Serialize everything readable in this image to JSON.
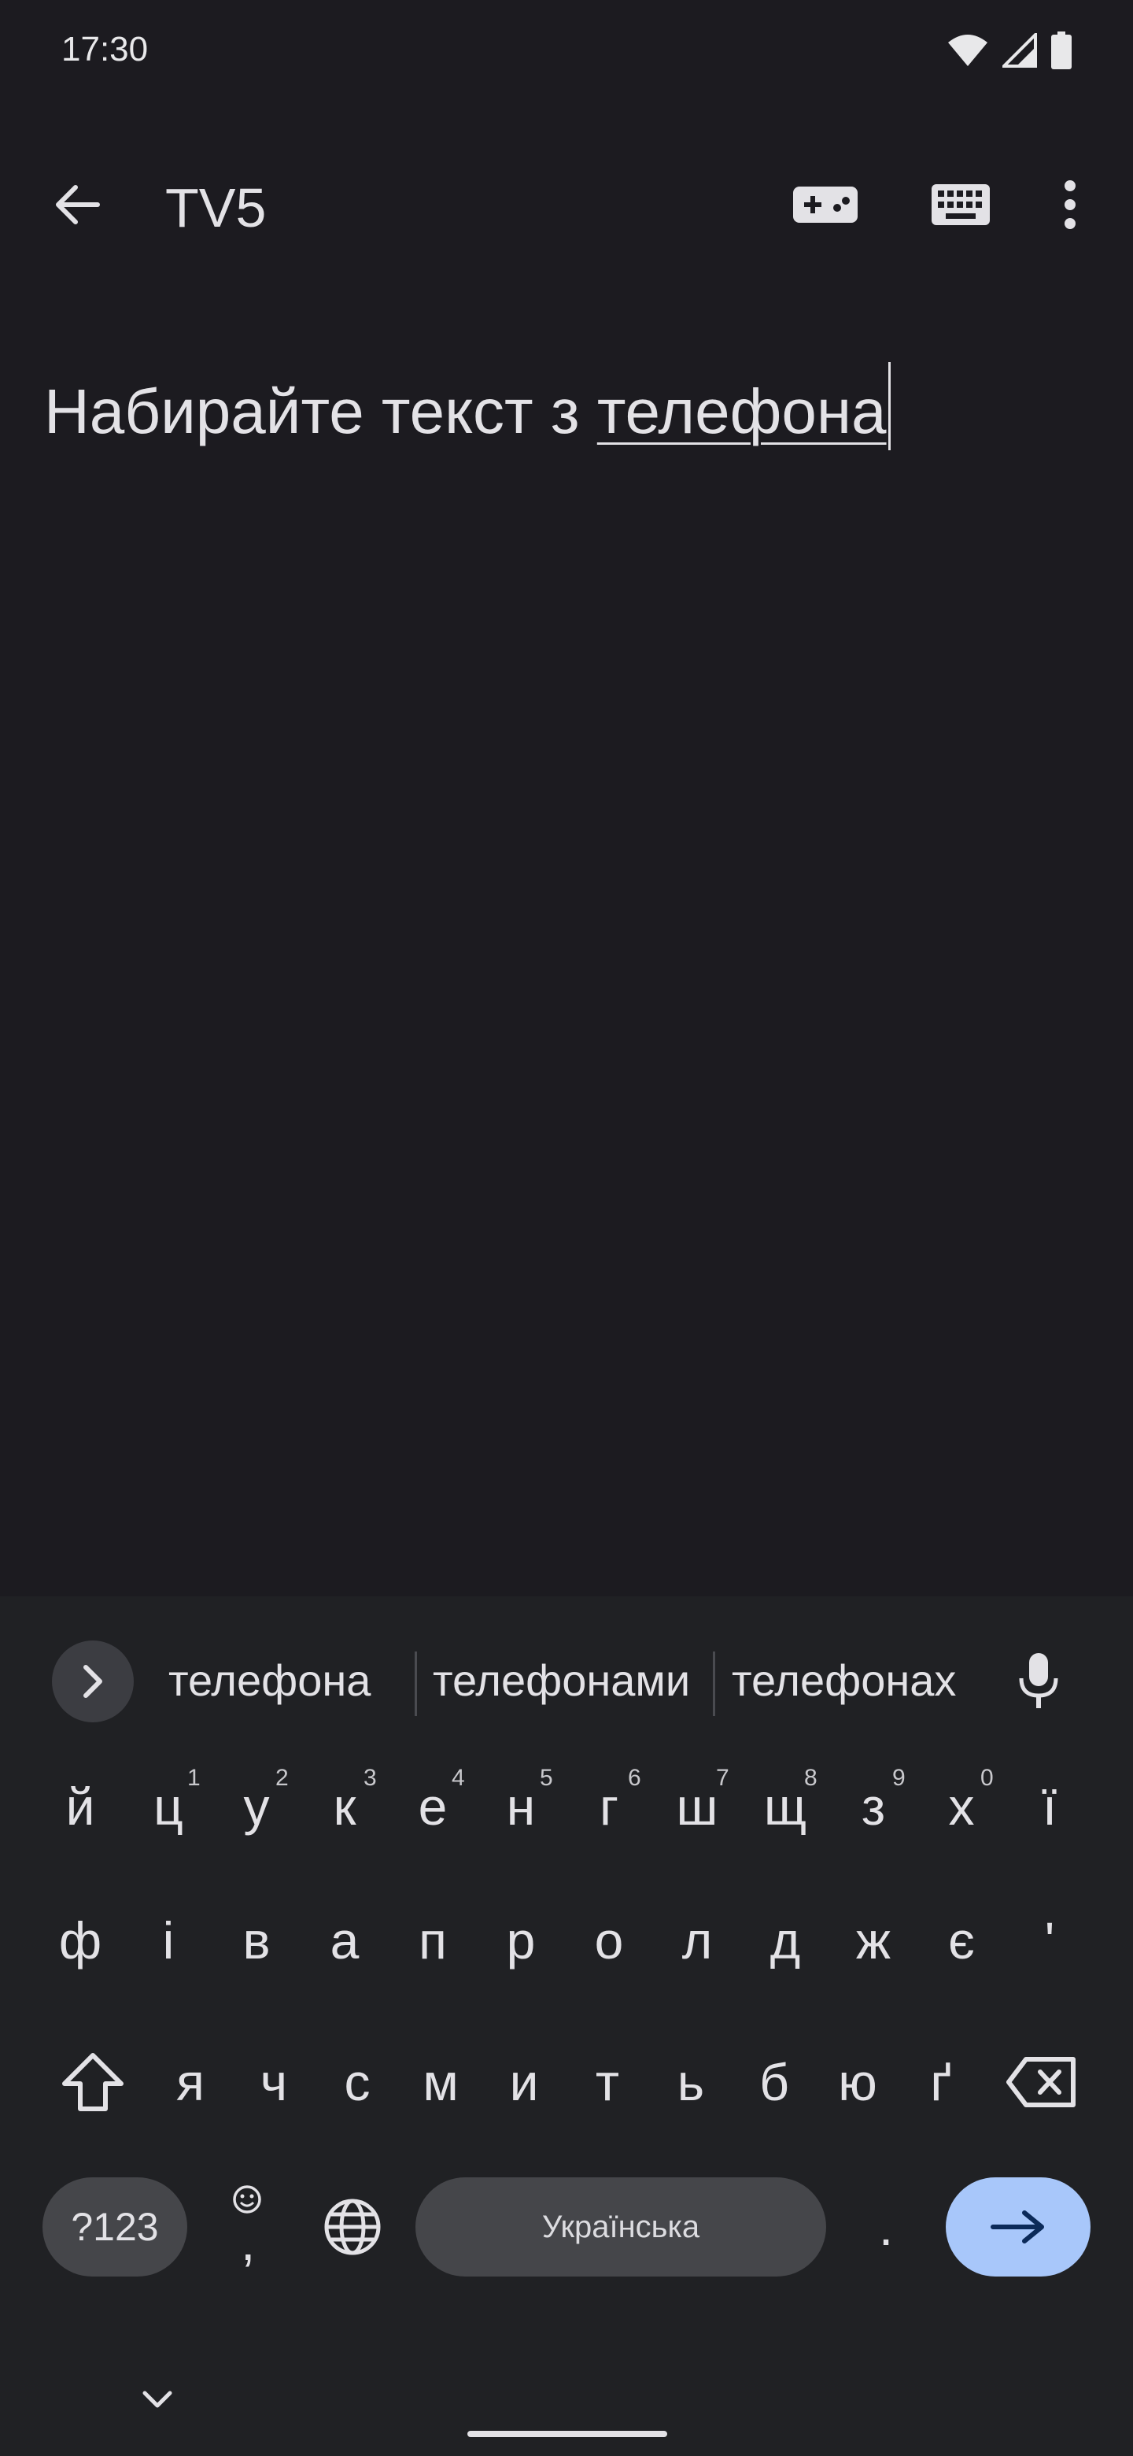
{
  "status_bar": {
    "time": "17:30"
  },
  "app_bar": {
    "title": "TV5"
  },
  "text_input": {
    "prefix": "Набирайте текст з ",
    "composing": "телефона"
  },
  "keyboard": {
    "suggestions": [
      "телефона",
      "телефонами",
      "телефонах"
    ],
    "row1": [
      {
        "key": "й",
        "hint": ""
      },
      {
        "key": "ц",
        "hint": "1"
      },
      {
        "key": "у",
        "hint": "2"
      },
      {
        "key": "к",
        "hint": "3"
      },
      {
        "key": "е",
        "hint": "4"
      },
      {
        "key": "н",
        "hint": "5"
      },
      {
        "key": "г",
        "hint": "6"
      },
      {
        "key": "ш",
        "hint": "7"
      },
      {
        "key": "щ",
        "hint": "8"
      },
      {
        "key": "з",
        "hint": "9"
      },
      {
        "key": "х",
        "hint": "0"
      },
      {
        "key": "ї",
        "hint": ""
      }
    ],
    "row2": [
      "ф",
      "і",
      "в",
      "а",
      "п",
      "р",
      "о",
      "л",
      "д",
      "ж",
      "є",
      "'"
    ],
    "row3": [
      "я",
      "ч",
      "с",
      "м",
      "и",
      "т",
      "ь",
      "б",
      "ю",
      "ґ"
    ],
    "symbols_label": "?123",
    "comma_label": ",",
    "space_label": "Українська",
    "period_label": "."
  },
  "colors": {
    "background": "#1c1b20",
    "keyboard_background": "#202124",
    "enter_key": "#a8c7fa",
    "pill_key": "#45464a"
  }
}
